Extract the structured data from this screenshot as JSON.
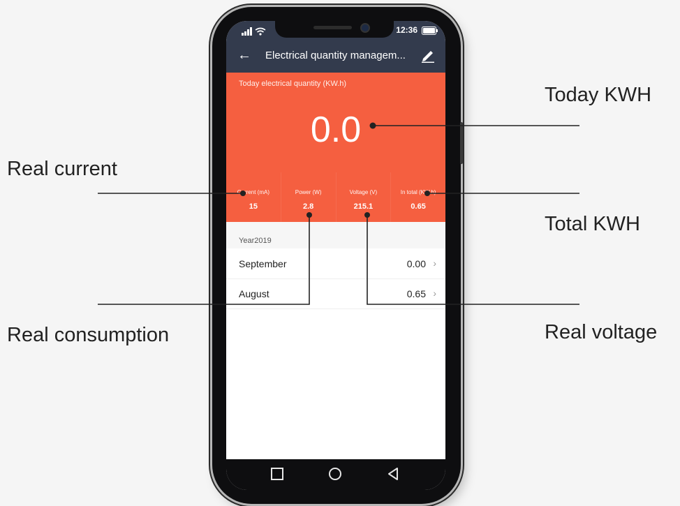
{
  "status_bar": {
    "time": "12:36"
  },
  "app_bar": {
    "title": "Electrical quantity managem..."
  },
  "hero": {
    "label": "Today electrical quantity (KW.h)",
    "value": "0.0",
    "stats": [
      {
        "label": "Current  (mA)",
        "value": "15"
      },
      {
        "label": "Power (W)",
        "value": "2.8"
      },
      {
        "label": "Voltage (V)",
        "value": "215.1"
      },
      {
        "label": "In total (KW.h)",
        "value": "0.65"
      }
    ]
  },
  "history": {
    "year_label": "Year2019",
    "rows": [
      {
        "month": "September",
        "value": "0.00"
      },
      {
        "month": "August",
        "value": "0.65"
      }
    ]
  },
  "callouts": {
    "today_kwh": "Today KWH",
    "real_current": "Real current",
    "total_kwh": "Total KWH",
    "real_consumption": "Real consumption",
    "real_voltage": "Real voltage"
  },
  "colors": {
    "header_bg": "#333b4d",
    "accent": "#f55f40",
    "page_bg": "#f5f5f5"
  },
  "icons": [
    "signal-icon",
    "wifi-icon",
    "battery-icon",
    "back-arrow-icon",
    "edit-icon",
    "chevron-right-icon",
    "nav-square-icon",
    "nav-circle-icon",
    "nav-back-triangle-icon"
  ]
}
